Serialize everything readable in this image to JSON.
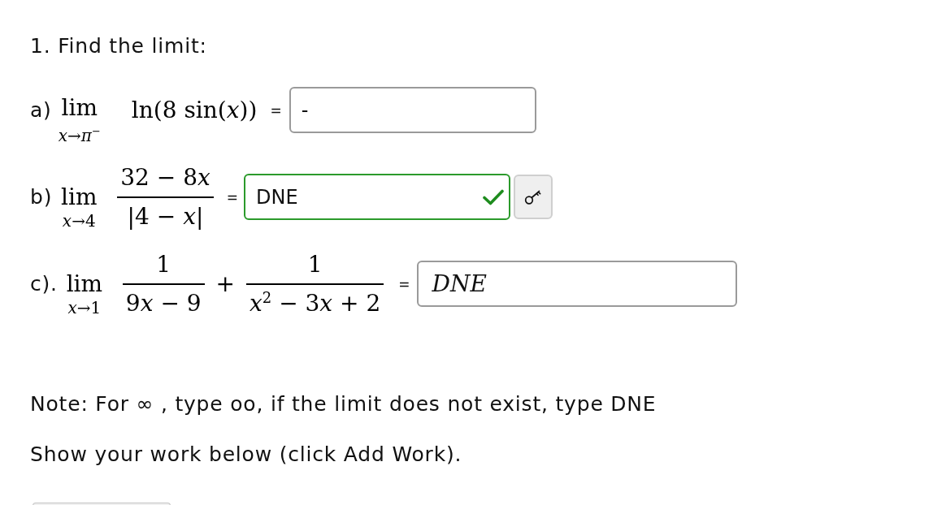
{
  "problem": {
    "title": "1. Find the limit:"
  },
  "parts": [
    {
      "label": "a)",
      "limit": {
        "operator": "lim",
        "approach": "x→π$^{−}$"
      },
      "expression": [
        {
          "kind": "text",
          "text": "ln(8 sin(x))"
        }
      ],
      "equals": "=",
      "answer": {
        "kind": "plain",
        "value": "-",
        "correct": false,
        "key_button": false
      }
    },
    {
      "label": "b)",
      "limit": {
        "operator": "lim",
        "approach": "x→4"
      },
      "expression": [
        {
          "kind": "fraction",
          "numerator": "32 − 8x",
          "denominator": "|4 − x|"
        }
      ],
      "equals": "=",
      "answer": {
        "kind": "plain",
        "value": "DNE",
        "correct": true,
        "key_button": true
      }
    },
    {
      "label": "c).",
      "limit": {
        "operator": "lim",
        "approach": "x→1"
      },
      "expression": [
        {
          "kind": "fraction",
          "numerator": "1",
          "denominator": "9x − 9"
        },
        {
          "kind": "operator",
          "text": "+"
        },
        {
          "kind": "fraction",
          "numerator": "1",
          "denominator": "x$^{2}$ − 3x + 2"
        }
      ],
      "equals": "=",
      "answer": {
        "kind": "math",
        "value": "DNE",
        "correct": false,
        "key_button": false
      }
    }
  ],
  "note": "Note: For ∞ , type oo, if the limit does not exist, type DNE",
  "instruction": "Show your work below (click Add Work)."
}
